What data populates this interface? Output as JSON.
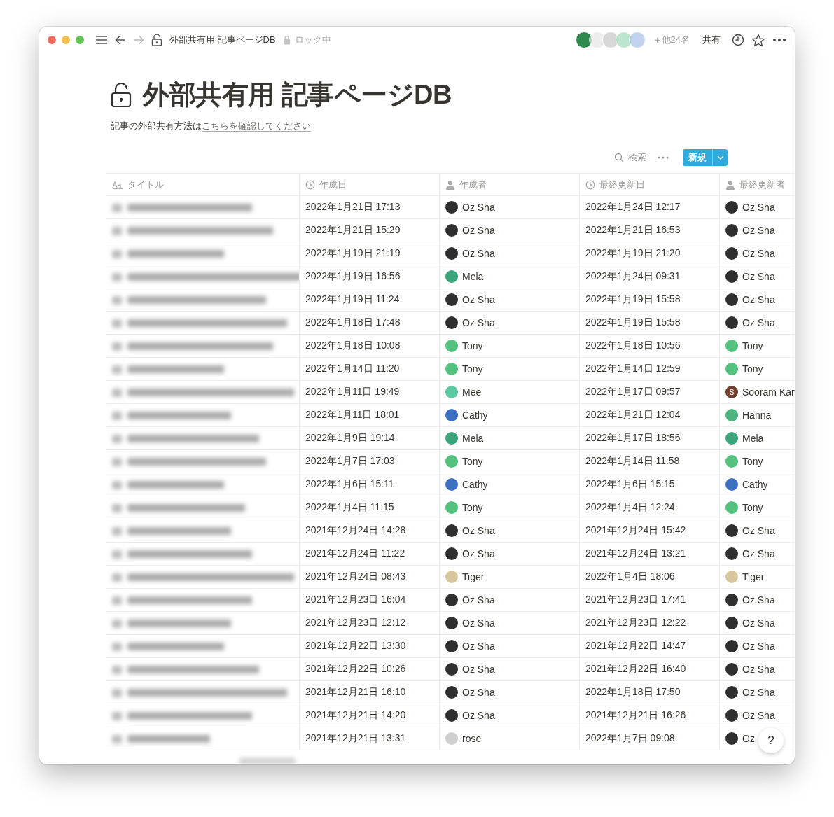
{
  "toolbar": {
    "breadcrumb": "外部共有用 記事ページDB",
    "lock_label": "ロック中",
    "others": "＋他24名",
    "share": "共有"
  },
  "page": {
    "title": "外部共有用 記事ページDB",
    "description_prefix": "記事の外部共有方法は",
    "description_link": "こちらを確認してください"
  },
  "view_actions": {
    "search": "検索",
    "new_button": "新規"
  },
  "table": {
    "columns": [
      {
        "label": "タイトル",
        "kind": "text"
      },
      {
        "label": "作成日",
        "kind": "clock"
      },
      {
        "label": "作成者",
        "kind": "person"
      },
      {
        "label": "最終更新日",
        "kind": "clock"
      },
      {
        "label": "最終更新者",
        "kind": "person"
      }
    ],
    "rows": [
      {
        "created": "2022年1月21日 17:13",
        "creator": {
          "name": "Oz Sha",
          "color": "#2f2f2f"
        },
        "updated": "2022年1月24日 12:17",
        "updater": {
          "name": "Oz Sha",
          "color": "#2f2f2f"
        }
      },
      {
        "created": "2022年1月21日 15:29",
        "creator": {
          "name": "Oz Sha",
          "color": "#2f2f2f"
        },
        "updated": "2022年1月21日 16:53",
        "updater": {
          "name": "Oz Sha",
          "color": "#2f2f2f"
        }
      },
      {
        "created": "2022年1月19日 21:19",
        "creator": {
          "name": "Oz Sha",
          "color": "#2f2f2f"
        },
        "updated": "2022年1月19日 21:20",
        "updater": {
          "name": "Oz Sha",
          "color": "#2f2f2f"
        }
      },
      {
        "created": "2022年1月19日 16:56",
        "creator": {
          "name": "Mela",
          "color": "#3aa57a"
        },
        "updated": "2022年1月24日 09:31",
        "updater": {
          "name": "Oz Sha",
          "color": "#2f2f2f"
        }
      },
      {
        "created": "2022年1月19日 11:24",
        "creator": {
          "name": "Oz Sha",
          "color": "#2f2f2f"
        },
        "updated": "2022年1月19日 15:58",
        "updater": {
          "name": "Oz Sha",
          "color": "#2f2f2f"
        }
      },
      {
        "created": "2022年1月18日 17:48",
        "creator": {
          "name": "Oz Sha",
          "color": "#2f2f2f"
        },
        "updated": "2022年1月19日 15:58",
        "updater": {
          "name": "Oz Sha",
          "color": "#2f2f2f"
        }
      },
      {
        "created": "2022年1月18日 10:08",
        "creator": {
          "name": "Tony",
          "color": "#52c27e"
        },
        "updated": "2022年1月18日 10:56",
        "updater": {
          "name": "Tony",
          "color": "#52c27e"
        }
      },
      {
        "created": "2022年1月14日 11:20",
        "creator": {
          "name": "Tony",
          "color": "#52c27e"
        },
        "updated": "2022年1月14日 12:59",
        "updater": {
          "name": "Tony",
          "color": "#52c27e"
        }
      },
      {
        "created": "2022年1月11日 19:49",
        "creator": {
          "name": "Mee",
          "color": "#5cc8a2"
        },
        "updated": "2022年1月17日 09:57",
        "updater": {
          "name": "Sooram Kar",
          "color": "#6e3f2e",
          "initial": "S"
        }
      },
      {
        "created": "2022年1月11日 18:01",
        "creator": {
          "name": "Cathy",
          "color": "#3c6fc2"
        },
        "updated": "2022年1月21日 12:04",
        "updater": {
          "name": "Hanna",
          "color": "#4cb57f"
        }
      },
      {
        "created": "2022年1月9日 19:14",
        "creator": {
          "name": "Mela",
          "color": "#3aa57a"
        },
        "updated": "2022年1月17日 18:56",
        "updater": {
          "name": "Mela",
          "color": "#3aa57a"
        }
      },
      {
        "created": "2022年1月7日 17:03",
        "creator": {
          "name": "Tony",
          "color": "#52c27e"
        },
        "updated": "2022年1月14日 11:58",
        "updater": {
          "name": "Tony",
          "color": "#52c27e"
        }
      },
      {
        "created": "2022年1月6日 15:11",
        "creator": {
          "name": "Cathy",
          "color": "#3c6fc2"
        },
        "updated": "2022年1月6日 15:15",
        "updater": {
          "name": "Cathy",
          "color": "#3c6fc2"
        }
      },
      {
        "created": "2022年1月4日 11:15",
        "creator": {
          "name": "Tony",
          "color": "#52c27e"
        },
        "updated": "2022年1月4日 12:24",
        "updater": {
          "name": "Tony",
          "color": "#52c27e"
        }
      },
      {
        "created": "2021年12月24日 14:28",
        "creator": {
          "name": "Oz Sha",
          "color": "#2f2f2f"
        },
        "updated": "2021年12月24日 15:42",
        "updater": {
          "name": "Oz Sha",
          "color": "#2f2f2f"
        }
      },
      {
        "created": "2021年12月24日 11:22",
        "creator": {
          "name": "Oz Sha",
          "color": "#2f2f2f"
        },
        "updated": "2021年12月24日 13:21",
        "updater": {
          "name": "Oz Sha",
          "color": "#2f2f2f"
        }
      },
      {
        "created": "2021年12月24日 08:43",
        "creator": {
          "name": "Tiger",
          "color": "#d8c79e"
        },
        "updated": "2022年1月4日 18:06",
        "updater": {
          "name": "Tiger",
          "color": "#d8c79e"
        }
      },
      {
        "created": "2021年12月23日 16:04",
        "creator": {
          "name": "Oz Sha",
          "color": "#2f2f2f"
        },
        "updated": "2021年12月23日 17:41",
        "updater": {
          "name": "Oz Sha",
          "color": "#2f2f2f"
        }
      },
      {
        "created": "2021年12月23日 12:12",
        "creator": {
          "name": "Oz Sha",
          "color": "#2f2f2f"
        },
        "updated": "2021年12月23日 12:22",
        "updater": {
          "name": "Oz Sha",
          "color": "#2f2f2f"
        }
      },
      {
        "created": "2021年12月22日 13:30",
        "creator": {
          "name": "Oz Sha",
          "color": "#2f2f2f"
        },
        "updated": "2021年12月22日 14:47",
        "updater": {
          "name": "Oz Sha",
          "color": "#2f2f2f"
        }
      },
      {
        "created": "2021年12月22日 10:26",
        "creator": {
          "name": "Oz Sha",
          "color": "#2f2f2f"
        },
        "updated": "2021年12月22日 16:40",
        "updater": {
          "name": "Oz Sha",
          "color": "#2f2f2f"
        }
      },
      {
        "created": "2021年12月21日 16:10",
        "creator": {
          "name": "Oz Sha",
          "color": "#2f2f2f"
        },
        "updated": "2022年1月18日 17:50",
        "updater": {
          "name": "Oz Sha",
          "color": "#2f2f2f"
        }
      },
      {
        "created": "2021年12月21日 14:20",
        "creator": {
          "name": "Oz Sha",
          "color": "#2f2f2f"
        },
        "updated": "2021年12月21日 16:26",
        "updater": {
          "name": "Oz Sha",
          "color": "#2f2f2f"
        }
      },
      {
        "created": "2021年12月21日 13:31",
        "creator": {
          "name": "rose",
          "color": "#cfcfcf"
        },
        "updated": "2022年1月7日 09:08",
        "updater": {
          "name": "Oz",
          "color": "#2f2f2f"
        }
      }
    ]
  },
  "help_button": "?"
}
